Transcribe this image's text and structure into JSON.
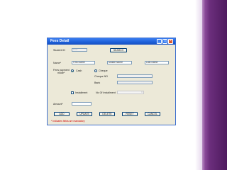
{
  "window": {
    "title": "Fees Detail",
    "minimize": "_",
    "maximize": "□",
    "close": "×"
  },
  "form": {
    "student_id_label": "Student ID",
    "student_id_value": "FEE",
    "search_label": "SEARCH",
    "name_label": "Name*",
    "first_name_placeholder": "First Name",
    "middle_name_placeholder": "Middle Name",
    "last_name_placeholder": "Last Name",
    "fees_payment_mode_label_line1": "Fees payment",
    "fees_payment_mode_label_line2": "mode*",
    "cash_label": "Cash",
    "cheque_label": "Cheque",
    "cheque_no_label": "Cheque NO",
    "bank_label": "Bank",
    "installment_label": "Installment",
    "no_of_installment_label": "No Of Installment",
    "amount_label": "Amount*"
  },
  "buttons": {
    "add": "ADD",
    "update": "UPDATE",
    "delete": "DELETE",
    "reset": "RESET",
    "cancel": "CANCEL"
  },
  "footer_note": "* Indicates fields are mandatory",
  "colors": {
    "title_bar": "#1c5fd8",
    "window_bg": "#ece9d8",
    "accent_band": "#6b2e7c",
    "note_text": "#d00000"
  }
}
